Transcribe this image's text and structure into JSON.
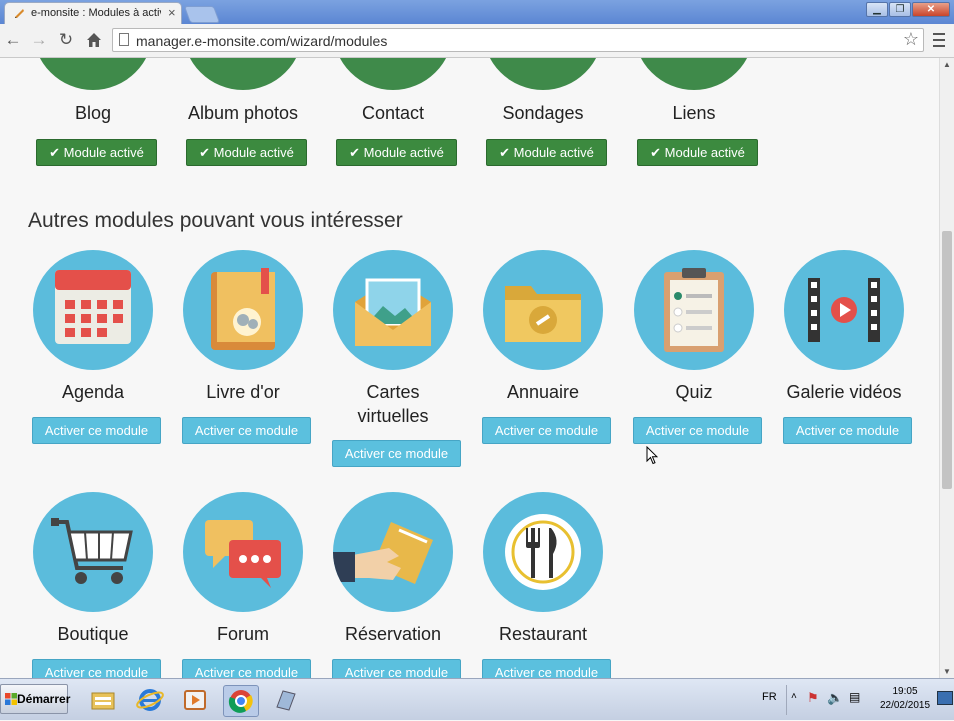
{
  "browser": {
    "tab_title": "e-monsite : Modules à activer",
    "tab_close": "×",
    "url": "manager.e-monsite.com/wizard/modules",
    "window_buttons": {
      "minimize": "▁",
      "maximize": "❐",
      "close": "✕"
    }
  },
  "active_modules": {
    "button_label": "Module activé",
    "items": [
      {
        "name": "Blog"
      },
      {
        "name": "Album photos"
      },
      {
        "name": "Contact"
      },
      {
        "name": "Sondages"
      },
      {
        "name": "Liens"
      }
    ]
  },
  "other_modules": {
    "section_title": "Autres modules pouvant vous intéresser",
    "button_label": "Activer ce module",
    "items": [
      {
        "name": "Agenda",
        "icon": "calendar-icon"
      },
      {
        "name": "Livre d'or",
        "icon": "guestbook-icon"
      },
      {
        "name": "Cartes virtuelles",
        "icon": "envelope-card-icon"
      },
      {
        "name": "Annuaire",
        "icon": "folder-link-icon"
      },
      {
        "name": "Quiz",
        "icon": "clipboard-quiz-icon"
      },
      {
        "name": "Galerie vidéos",
        "icon": "video-film-icon"
      },
      {
        "name": "Boutique",
        "icon": "shopping-cart-icon"
      },
      {
        "name": "Forum",
        "icon": "chat-bubbles-icon"
      },
      {
        "name": "Réservation",
        "icon": "ticket-hand-icon"
      },
      {
        "name": "Restaurant",
        "icon": "plate-cutlery-icon"
      }
    ]
  },
  "taskbar": {
    "start_label": "Démarrer",
    "language": "FR",
    "time": "19:05",
    "date": "22/02/2015"
  },
  "colors": {
    "active_green": "#3c8a3f",
    "activate_blue": "#5bc0de",
    "icon_circle_blue": "#5bbcdc"
  }
}
